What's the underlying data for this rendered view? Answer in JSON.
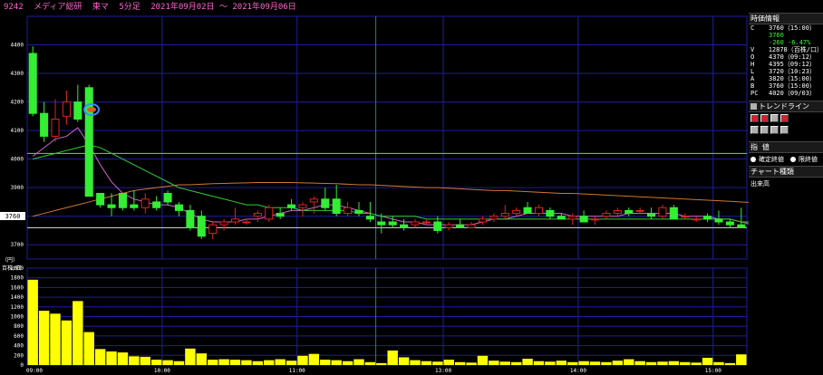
{
  "title": {
    "code": "9242",
    "name": "メディア総研",
    "market": "東マ",
    "interval": "5分足",
    "range": "2021年09月02日 〜 2021年09月06日"
  },
  "quote": {
    "header": "時価情報",
    "rows": [
      {
        "k": "C",
        "v": "3760（15:00）",
        "color": "#ffffff"
      },
      {
        "k": "",
        "v": "3760",
        "color": "#33ff33"
      },
      {
        "k": "",
        "v": "-260 -6.47%",
        "color": "#33ff33"
      },
      {
        "k": "V",
        "v": "12878（百株/口）",
        "color": "#ffffff"
      },
      {
        "k": "O",
        "v": "4370（09:12）",
        "color": "#ffffff"
      },
      {
        "k": "H",
        "v": "4395（09:12）",
        "color": "#ffffff"
      },
      {
        "k": "L",
        "v": "3720（10:23）",
        "color": "#ffffff"
      },
      {
        "k": "A",
        "v": "3820（15:00）",
        "color": "#ffffff"
      },
      {
        "k": "B",
        "v": "3760（15:00）",
        "color": "#ffffff"
      },
      {
        "k": "PC",
        "v": "4020（09/03）",
        "color": "#ffffff"
      }
    ]
  },
  "trendline": {
    "header": "トレンドライン"
  },
  "technical": {
    "header": "指 値",
    "options": [
      "確定終値",
      "限終値"
    ]
  },
  "chart_kind": {
    "header": "チャート種類",
    "value": "出来高"
  },
  "price_unit": "（円）",
  "volume_unit": "百株/口",
  "current_price_label": "3760",
  "chart_data": {
    "type": "candlestick",
    "price_ylim": [
      3650,
      4500
    ],
    "price_ticks": [
      3700,
      3800,
      3900,
      4000,
      4100,
      4200,
      4300,
      4400
    ],
    "volume_ylim": [
      0,
      2000
    ],
    "volume_ticks": [
      0,
      200,
      400,
      600,
      800,
      1000,
      1200,
      1400,
      1600,
      1800,
      2000
    ],
    "time_labels": [
      "09:00",
      "10:00",
      "11:00",
      "13:00",
      "14:00",
      "15:00"
    ],
    "time_label_index": [
      0,
      12,
      24,
      37,
      49,
      61
    ],
    "lunch_break_index": 31,
    "reference_lines": [
      {
        "name": "前日終値",
        "value": 4020,
        "color": "#33ff33"
      },
      {
        "name": "現在値",
        "value": 3760,
        "color": "#dddddd"
      }
    ],
    "candles": [
      {
        "o": 4370,
        "h": 4395,
        "l": 4150,
        "c": 4160
      },
      {
        "o": 4160,
        "h": 4200,
        "l": 4060,
        "c": 4080
      },
      {
        "o": 4080,
        "h": 4210,
        "l": 4060,
        "c": 4140
      },
      {
        "o": 4150,
        "h": 4240,
        "l": 4120,
        "c": 4200
      },
      {
        "o": 4200,
        "h": 4260,
        "l": 4130,
        "c": 4140
      },
      {
        "o": 4250,
        "h": 4260,
        "l": 3870,
        "c": 3870
      },
      {
        "o": 3880,
        "h": 3880,
        "l": 3830,
        "c": 3840
      },
      {
        "o": 3840,
        "h": 3880,
        "l": 3800,
        "c": 3830
      },
      {
        "o": 3880,
        "h": 3880,
        "l": 3820,
        "c": 3830
      },
      {
        "o": 3840,
        "h": 3890,
        "l": 3820,
        "c": 3830
      },
      {
        "o": 3830,
        "h": 3880,
        "l": 3810,
        "c": 3860
      },
      {
        "o": 3850,
        "h": 3870,
        "l": 3820,
        "c": 3830
      },
      {
        "o": 3880,
        "h": 3890,
        "l": 3840,
        "c": 3850
      },
      {
        "o": 3840,
        "h": 3850,
        "l": 3800,
        "c": 3820
      },
      {
        "o": 3820,
        "h": 3840,
        "l": 3750,
        "c": 3760
      },
      {
        "o": 3800,
        "h": 3820,
        "l": 3720,
        "c": 3730
      },
      {
        "o": 3740,
        "h": 3780,
        "l": 3720,
        "c": 3770
      },
      {
        "o": 3770,
        "h": 3790,
        "l": 3750,
        "c": 3780
      },
      {
        "o": 3780,
        "h": 3830,
        "l": 3770,
        "c": 3790
      },
      {
        "o": 3780,
        "h": 3790,
        "l": 3770,
        "c": 3780
      },
      {
        "o": 3800,
        "h": 3820,
        "l": 3780,
        "c": 3810
      },
      {
        "o": 3790,
        "h": 3840,
        "l": 3780,
        "c": 3830
      },
      {
        "o": 3810,
        "h": 3830,
        "l": 3790,
        "c": 3800
      },
      {
        "o": 3840,
        "h": 3860,
        "l": 3820,
        "c": 3830
      },
      {
        "o": 3830,
        "h": 3850,
        "l": 3800,
        "c": 3840
      },
      {
        "o": 3850,
        "h": 3870,
        "l": 3810,
        "c": 3860
      },
      {
        "o": 3860,
        "h": 3900,
        "l": 3820,
        "c": 3830
      },
      {
        "o": 3860,
        "h": 3910,
        "l": 3800,
        "c": 3810
      },
      {
        "o": 3810,
        "h": 3850,
        "l": 3800,
        "c": 3830
      },
      {
        "o": 3820,
        "h": 3850,
        "l": 3800,
        "c": 3810
      },
      {
        "o": 3800,
        "h": 3850,
        "l": 3780,
        "c": 3790
      },
      {
        "o": 3780,
        "h": 3810,
        "l": 3740,
        "c": 3770
      },
      {
        "o": 3780,
        "h": 3800,
        "l": 3760,
        "c": 3770
      },
      {
        "o": 3770,
        "h": 3790,
        "l": 3750,
        "c": 3760
      },
      {
        "o": 3770,
        "h": 3790,
        "l": 3760,
        "c": 3780
      },
      {
        "o": 3780,
        "h": 3790,
        "l": 3770,
        "c": 3780
      },
      {
        "o": 3780,
        "h": 3800,
        "l": 3740,
        "c": 3750
      },
      {
        "o": 3760,
        "h": 3780,
        "l": 3750,
        "c": 3770
      },
      {
        "o": 3770,
        "h": 3790,
        "l": 3760,
        "c": 3760
      },
      {
        "o": 3760,
        "h": 3780,
        "l": 3760,
        "c": 3770
      },
      {
        "o": 3780,
        "h": 3800,
        "l": 3770,
        "c": 3790
      },
      {
        "o": 3790,
        "h": 3810,
        "l": 3780,
        "c": 3800
      },
      {
        "o": 3800,
        "h": 3840,
        "l": 3790,
        "c": 3810
      },
      {
        "o": 3810,
        "h": 3830,
        "l": 3800,
        "c": 3820
      },
      {
        "o": 3830,
        "h": 3850,
        "l": 3810,
        "c": 3810
      },
      {
        "o": 3810,
        "h": 3840,
        "l": 3800,
        "c": 3830
      },
      {
        "o": 3820,
        "h": 3830,
        "l": 3790,
        "c": 3800
      },
      {
        "o": 3800,
        "h": 3810,
        "l": 3790,
        "c": 3790
      },
      {
        "o": 3790,
        "h": 3810,
        "l": 3770,
        "c": 3800
      },
      {
        "o": 3800,
        "h": 3820,
        "l": 3780,
        "c": 3780
      },
      {
        "o": 3790,
        "h": 3800,
        "l": 3770,
        "c": 3790
      },
      {
        "o": 3800,
        "h": 3820,
        "l": 3790,
        "c": 3810
      },
      {
        "o": 3810,
        "h": 3830,
        "l": 3800,
        "c": 3820
      },
      {
        "o": 3820,
        "h": 3830,
        "l": 3800,
        "c": 3810
      },
      {
        "o": 3820,
        "h": 3830,
        "l": 3810,
        "c": 3820
      },
      {
        "o": 3810,
        "h": 3830,
        "l": 3790,
        "c": 3800
      },
      {
        "o": 3800,
        "h": 3840,
        "l": 3790,
        "c": 3830
      },
      {
        "o": 3830,
        "h": 3840,
        "l": 3790,
        "c": 3790
      },
      {
        "o": 3800,
        "h": 3810,
        "l": 3790,
        "c": 3800
      },
      {
        "o": 3790,
        "h": 3800,
        "l": 3780,
        "c": 3790
      },
      {
        "o": 3800,
        "h": 3810,
        "l": 3780,
        "c": 3790
      },
      {
        "o": 3790,
        "h": 3820,
        "l": 3770,
        "c": 3780
      },
      {
        "o": 3780,
        "h": 3790,
        "l": 3760,
        "c": 3770
      },
      {
        "o": 3770,
        "h": 3830,
        "l": 3760,
        "c": 3760
      }
    ],
    "volume": [
      1760,
      1120,
      1060,
      920,
      1320,
      680,
      330,
      280,
      260,
      180,
      170,
      110,
      100,
      80,
      340,
      240,
      110,
      120,
      110,
      100,
      80,
      100,
      120,
      90,
      190,
      230,
      110,
      100,
      80,
      120,
      60,
      40,
      300,
      160,
      100,
      80,
      70,
      110,
      60,
      50,
      190,
      90,
      70,
      60,
      130,
      80,
      70,
      90,
      60,
      80,
      70,
      60,
      90,
      120,
      80,
      60,
      70,
      80,
      60,
      50,
      150,
      60,
      40,
      220,
      230
    ],
    "ma_short": [
      4010,
      4040,
      4070,
      4080,
      4110,
      4050,
      3980,
      3920,
      3880,
      3860,
      3850,
      3840,
      3840,
      3830,
      3810,
      3790,
      3780,
      3780,
      3780,
      3790,
      3790,
      3800,
      3810,
      3820,
      3820,
      3830,
      3840,
      3840,
      3830,
      3820,
      3810,
      3800,
      3790,
      3780,
      3780,
      3770,
      3770,
      3770,
      3770,
      3770,
      3780,
      3790,
      3790,
      3800,
      3810,
      3810,
      3810,
      3810,
      3800,
      3800,
      3800,
      3800,
      3800,
      3810,
      3810,
      3810,
      3810,
      3810,
      3800,
      3800,
      3800,
      3790,
      3790,
      3780,
      3770
    ],
    "ma_mid": [
      4000,
      4010,
      4020,
      4030,
      4040,
      4050,
      4040,
      4020,
      4000,
      3980,
      3960,
      3940,
      3920,
      3900,
      3890,
      3880,
      3870,
      3860,
      3850,
      3840,
      3840,
      3830,
      3830,
      3830,
      3820,
      3820,
      3820,
      3820,
      3820,
      3810,
      3810,
      3800,
      3800,
      3800,
      3800,
      3790,
      3790,
      3790,
      3790,
      3790,
      3790,
      3790,
      3790,
      3790,
      3790,
      3790,
      3790,
      3790,
      3790,
      3790,
      3790,
      3790,
      3790,
      3790,
      3790,
      3790,
      3790,
      3790,
      3790,
      3790,
      3790,
      3790,
      3790,
      3780,
      3780
    ],
    "ma_long": [
      3800,
      3810,
      3820,
      3830,
      3840,
      3850,
      3860,
      3870,
      3880,
      3890,
      3895,
      3900,
      3905,
      3910,
      3910,
      3912,
      3914,
      3915,
      3916,
      3917,
      3918,
      3918,
      3918,
      3918,
      3917,
      3916,
      3915,
      3914,
      3912,
      3910,
      3910,
      3908,
      3906,
      3904,
      3902,
      3900,
      3900,
      3898,
      3896,
      3894,
      3892,
      3890,
      3890,
      3888,
      3886,
      3884,
      3882,
      3880,
      3880,
      3878,
      3876,
      3874,
      3872,
      3870,
      3868,
      3866,
      3864,
      3862,
      3860,
      3858,
      3856,
      3854,
      3852,
      3850,
      3848
    ]
  }
}
